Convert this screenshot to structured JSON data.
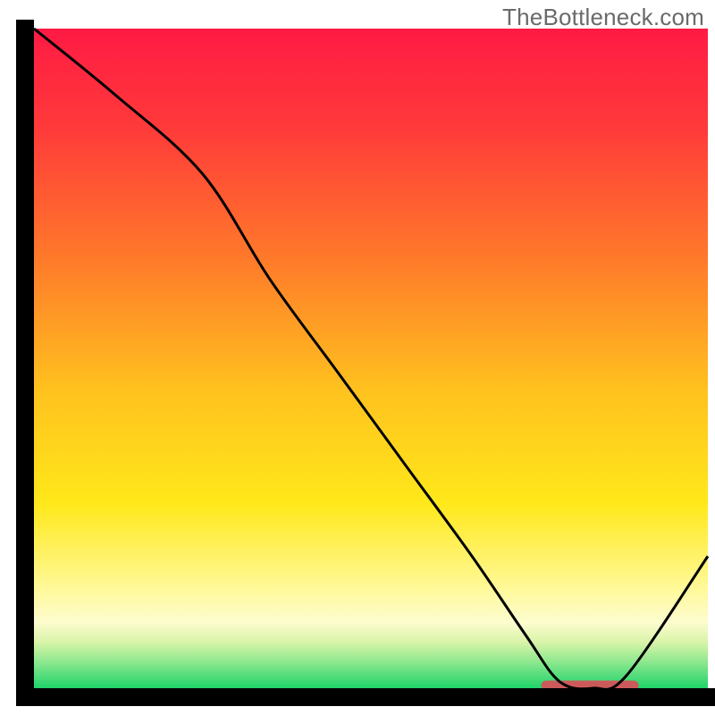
{
  "watermark": "TheBottleneck.com",
  "chart_data": {
    "type": "line",
    "title": "",
    "xlabel": "",
    "ylabel": "",
    "x_range": [
      0,
      100
    ],
    "y_range": [
      0,
      100
    ],
    "series": [
      {
        "name": "bottleneck-curve",
        "x": [
          0,
          12,
          25,
          35,
          45,
          55,
          65,
          73,
          78,
          83,
          88,
          100
        ],
        "y": [
          100,
          90,
          78,
          62,
          48,
          34,
          20,
          8,
          1,
          0,
          2,
          20
        ]
      }
    ],
    "optimal_band": {
      "x_start": 76,
      "x_end": 89,
      "y": 0.4
    },
    "gradient_stops": [
      {
        "offset": 0.0,
        "color": "#ff1a44"
      },
      {
        "offset": 0.15,
        "color": "#ff3a3a"
      },
      {
        "offset": 0.35,
        "color": "#ff7a2a"
      },
      {
        "offset": 0.55,
        "color": "#ffc21e"
      },
      {
        "offset": 0.72,
        "color": "#ffe81a"
      },
      {
        "offset": 0.85,
        "color": "#fff99a"
      },
      {
        "offset": 0.9,
        "color": "#fdfccf"
      },
      {
        "offset": 0.93,
        "color": "#d9f4a8"
      },
      {
        "offset": 0.96,
        "color": "#8ee88f"
      },
      {
        "offset": 1.0,
        "color": "#1fd36a"
      }
    ],
    "axis_color": "#000000",
    "axis_width": 20,
    "curve_color": "#000000",
    "curve_width": 3,
    "marker_color": "#cc5a5a"
  }
}
